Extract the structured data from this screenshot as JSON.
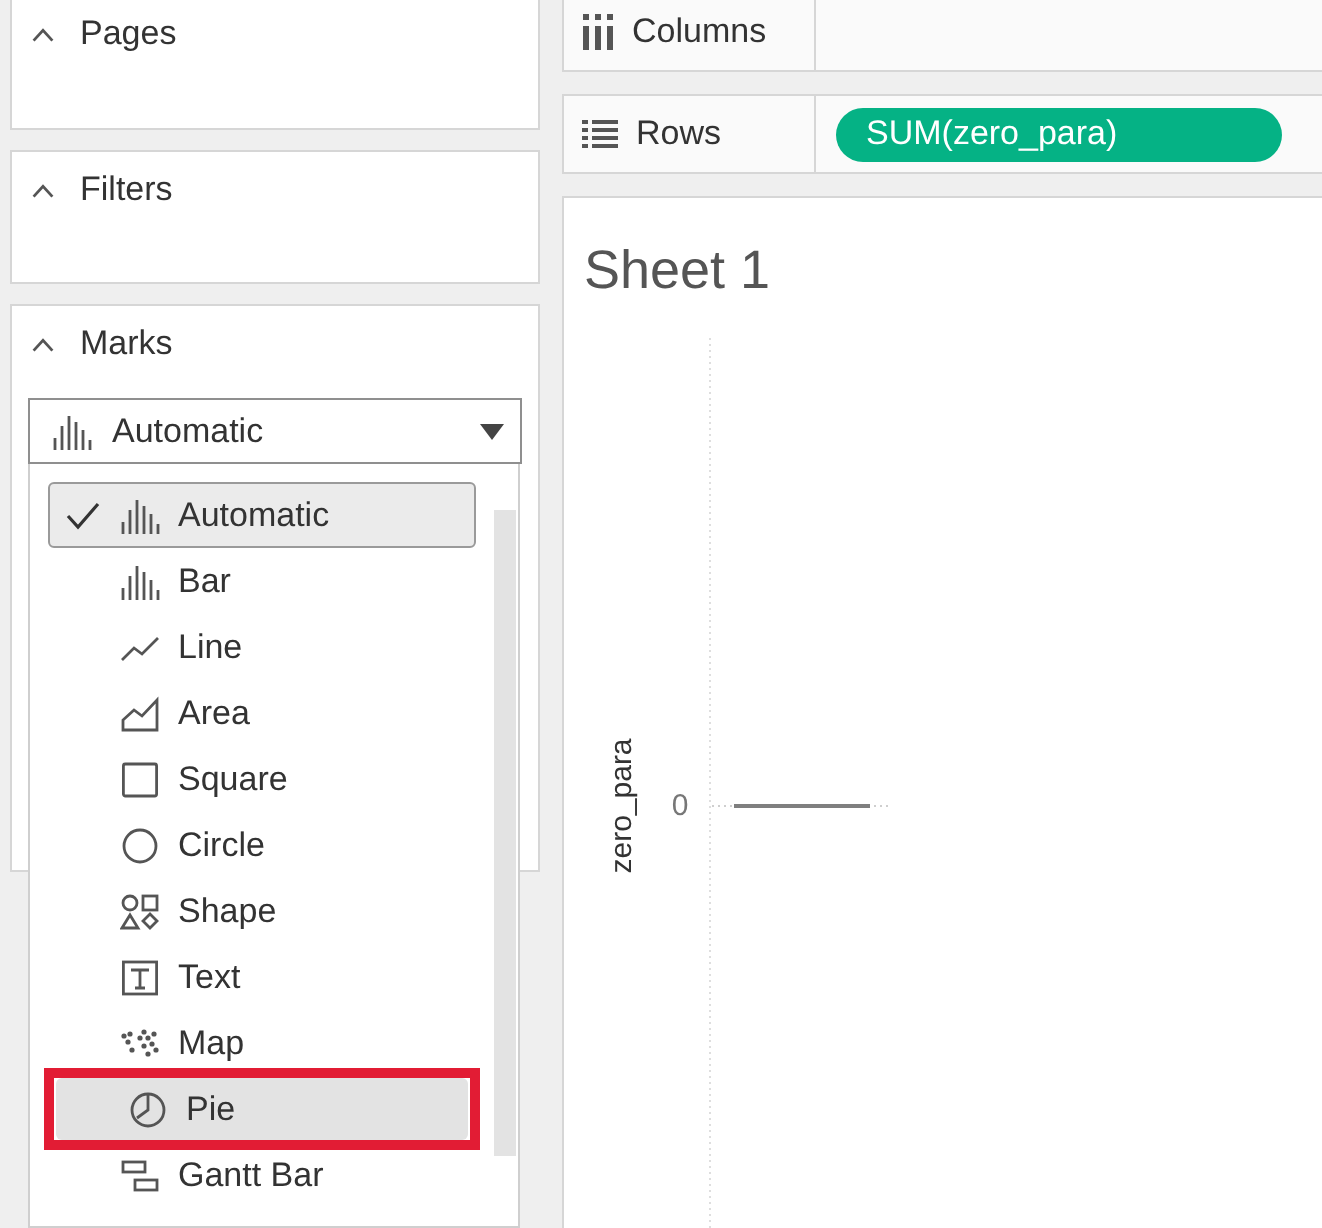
{
  "side_panel": {
    "cards": [
      {
        "title": "Pages",
        "expanded": true
      },
      {
        "title": "Filters",
        "expanded": true
      },
      {
        "title": "Marks",
        "expanded": true,
        "dropdown": {
          "value": "Automatic",
          "kind": "automatic",
          "open": true,
          "items": [
            {
              "label": "Automatic",
              "kind": "automatic",
              "selected": true,
              "hovered": false,
              "highlighted": false
            },
            {
              "label": "Bar",
              "kind": "bar",
              "selected": false,
              "hovered": false,
              "highlighted": false
            },
            {
              "label": "Line",
              "kind": "line",
              "selected": false,
              "hovered": false,
              "highlighted": false
            },
            {
              "label": "Area",
              "kind": "area",
              "selected": false,
              "hovered": false,
              "highlighted": false
            },
            {
              "label": "Square",
              "kind": "square",
              "selected": false,
              "hovered": false,
              "highlighted": false
            },
            {
              "label": "Circle",
              "kind": "circle",
              "selected": false,
              "hovered": false,
              "highlighted": false
            },
            {
              "label": "Shape",
              "kind": "shape",
              "selected": false,
              "hovered": false,
              "highlighted": false
            },
            {
              "label": "Text",
              "kind": "text",
              "selected": false,
              "hovered": false,
              "highlighted": false
            },
            {
              "label": "Map",
              "kind": "map",
              "selected": false,
              "hovered": false,
              "highlighted": false
            },
            {
              "label": "Pie",
              "kind": "pie",
              "selected": false,
              "hovered": true,
              "highlighted": true
            },
            {
              "label": "Gantt Bar",
              "kind": "gantt",
              "selected": false,
              "hovered": false,
              "highlighted": false
            }
          ]
        }
      }
    ]
  },
  "shelves": [
    {
      "label": "Columns",
      "kind": "columns"
    },
    {
      "label": "Rows",
      "kind": "rows",
      "pills": [
        "SUM(zero_para)"
      ]
    }
  ],
  "view": {
    "title": "Sheet 1",
    "axis_title": "zero_para",
    "axis_tick": "0"
  }
}
